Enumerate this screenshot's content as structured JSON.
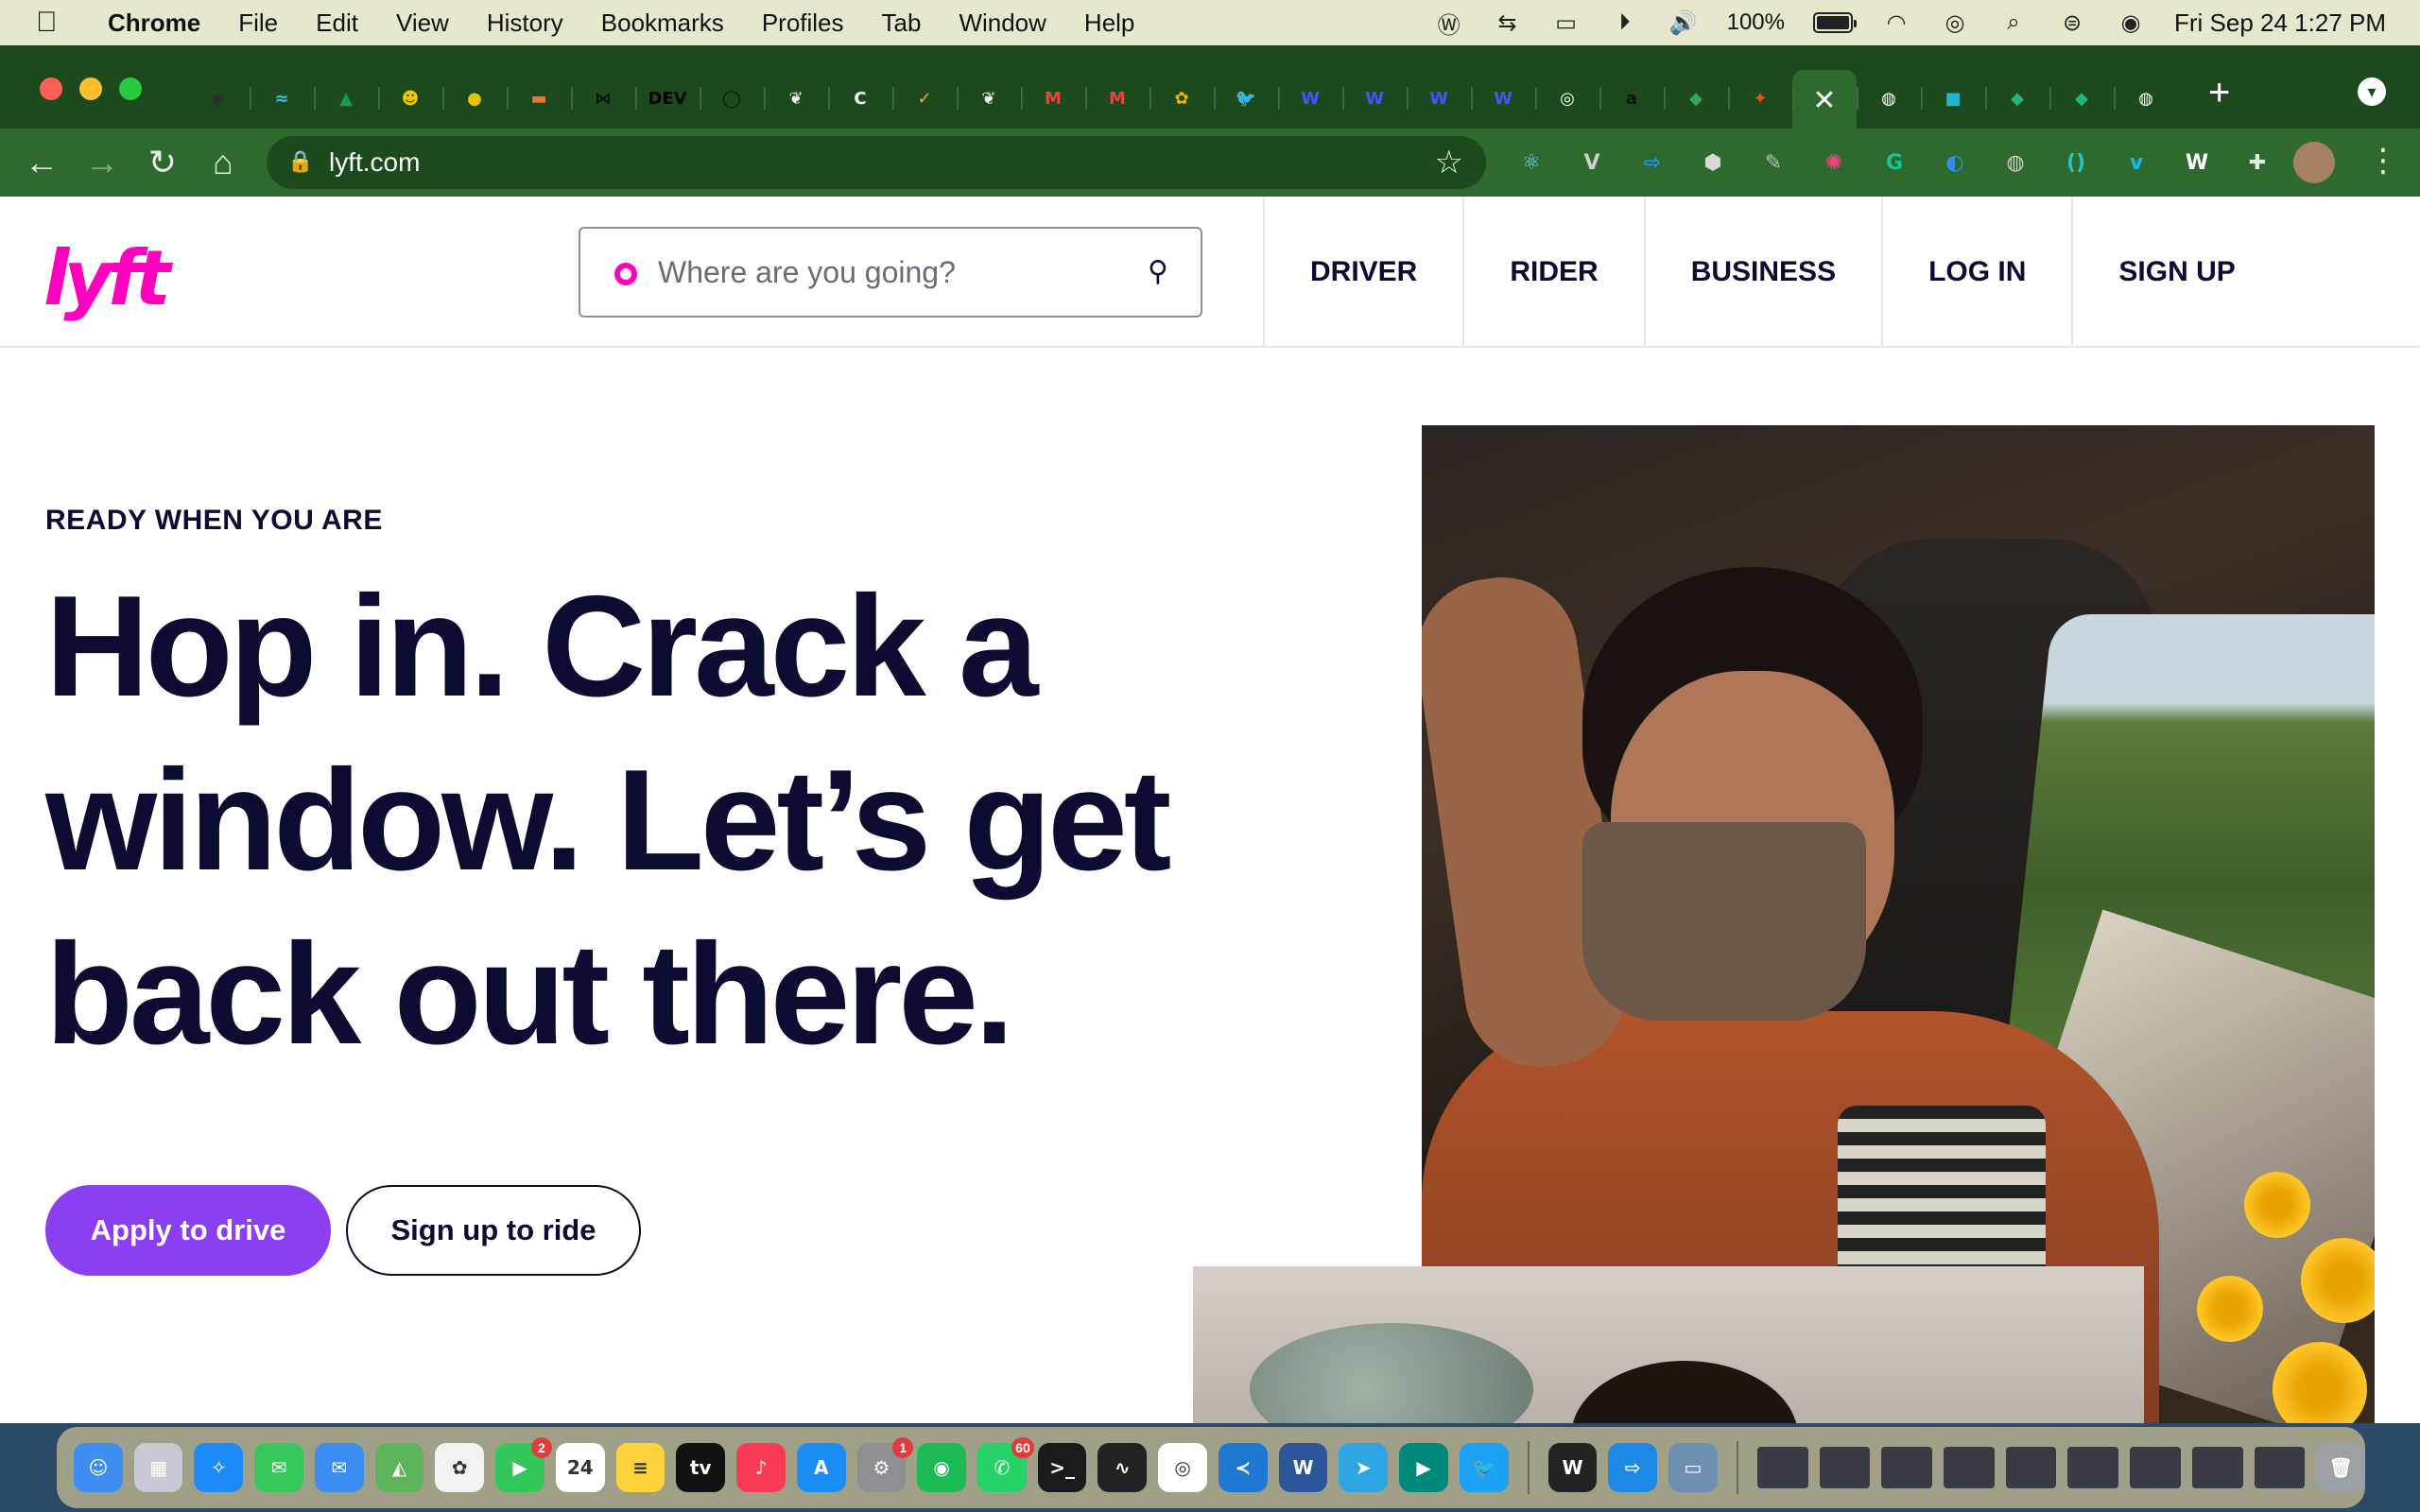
{
  "menubar": {
    "apple": "",
    "app_name": "Chrome",
    "menus": [
      "File",
      "Edit",
      "View",
      "History",
      "Bookmarks",
      "Profiles",
      "Tab",
      "Window",
      "Help"
    ],
    "battery_percent": "100%",
    "battery_level": 1.0,
    "datetime": "Fri Sep 24  1:27 PM"
  },
  "browser": {
    "tabs": [
      {
        "icon": "shield-icon",
        "glyph": "◉",
        "color": "#2d2d2d"
      },
      {
        "icon": "tailwind-icon",
        "glyph": "≈",
        "color": "#38bdf8"
      },
      {
        "icon": "mountain-icon",
        "glyph": "▲",
        "color": "#0f9d58"
      },
      {
        "icon": "emoji-icon",
        "glyph": "☻",
        "color": "#f7c400"
      },
      {
        "icon": "coin-icon",
        "glyph": "●",
        "color": "#e6c300"
      },
      {
        "icon": "stack-icon",
        "glyph": "▬",
        "color": "#e0773c"
      },
      {
        "icon": "bowtie-icon",
        "glyph": "⋈",
        "color": "#111111"
      },
      {
        "icon": "dev-icon",
        "glyph": "DEV",
        "color": "#000000"
      },
      {
        "icon": "github-icon",
        "glyph": "◯",
        "color": "#111111"
      },
      {
        "icon": "leaf-icon",
        "glyph": "❦",
        "color": "#e8f5e9"
      },
      {
        "icon": "c-icon",
        "glyph": "C",
        "color": "#ffffff"
      },
      {
        "icon": "check-icon",
        "glyph": "✓",
        "color": "#f2a93b"
      },
      {
        "icon": "leaf-icon-2",
        "glyph": "❦",
        "color": "#e8f5e9"
      },
      {
        "icon": "gmail-icon",
        "glyph": "M",
        "color": "#ea4335"
      },
      {
        "icon": "gmail-icon-2",
        "glyph": "M",
        "color": "#ea4335"
      },
      {
        "icon": "flower-icon",
        "glyph": "✿",
        "color": "#f4b400"
      },
      {
        "icon": "twitter-icon",
        "glyph": "🐦",
        "color": "#1da1f2"
      },
      {
        "icon": "webflow-icon",
        "glyph": "W",
        "color": "#4353ff"
      },
      {
        "icon": "webflow-icon-2",
        "glyph": "W",
        "color": "#4353ff"
      },
      {
        "icon": "webflow-icon-3",
        "glyph": "W",
        "color": "#4353ff"
      },
      {
        "icon": "webflow-icon-4",
        "glyph": "W",
        "color": "#4353ff"
      },
      {
        "icon": "chrome-icon",
        "glyph": "◎",
        "color": "#ffffff"
      },
      {
        "icon": "amazon-icon",
        "glyph": "a",
        "color": "#111111"
      },
      {
        "icon": "maps-icon",
        "glyph": "◆",
        "color": "#34a853"
      },
      {
        "icon": "figma-icon",
        "glyph": "✦",
        "color": "#f24e1e"
      },
      {
        "icon": "close-icon",
        "glyph": "✕",
        "color": "#2e6a2e",
        "active": true
      },
      {
        "icon": "globe-icon",
        "glyph": "◍",
        "color": "#ffffff"
      },
      {
        "icon": "square-icon",
        "glyph": "■",
        "color": "#1fb6d5"
      },
      {
        "icon": "diamond-icon",
        "glyph": "◆",
        "color": "#1db97a"
      },
      {
        "icon": "diamond-icon-2",
        "glyph": "◆",
        "color": "#1db97a"
      },
      {
        "icon": "globe-icon-2",
        "glyph": "◍",
        "color": "#ffffff"
      }
    ],
    "url": "lyft.com",
    "extensions": [
      {
        "icon": "react-icon",
        "glyph": "⚛",
        "color": "#61dafb"
      },
      {
        "icon": "vue-icon",
        "glyph": "V",
        "color": "#cfcfcf"
      },
      {
        "icon": "arrow-box-icon",
        "glyph": "⇨",
        "color": "#2196f3"
      },
      {
        "icon": "cube-icon",
        "glyph": "⬢",
        "color": "#d8d8d8"
      },
      {
        "icon": "pen-icon",
        "glyph": "✎",
        "color": "#bdbdbd"
      },
      {
        "icon": "color-wheel-icon",
        "glyph": "✺",
        "color": "#ff4081"
      },
      {
        "icon": "grammarly-icon",
        "glyph": "G",
        "color": "#15c39a"
      },
      {
        "icon": "edge-icon",
        "glyph": "◐",
        "color": "#2a8cff"
      },
      {
        "icon": "globe-ext-icon",
        "glyph": "◍",
        "color": "#d0d0d0"
      },
      {
        "icon": "bracket-icon",
        "glyph": "()",
        "color": "#27c6c6"
      },
      {
        "icon": "vimeo-icon",
        "glyph": "v",
        "color": "#1ab7ea"
      },
      {
        "icon": "w-circle-icon",
        "glyph": "W",
        "color": "#ffffff"
      },
      {
        "icon": "puzzle-icon",
        "glyph": "✚",
        "color": "#e5efe5"
      }
    ]
  },
  "site": {
    "logo_text": "lyft",
    "search_placeholder": "Where are you going?",
    "nav": [
      "DRIVER",
      "RIDER",
      "BUSINESS",
      "LOG IN",
      "SIGN UP"
    ],
    "eyebrow": "READY WHEN YOU ARE",
    "headline": "Hop in. Crack a window. Let’s get back out there.",
    "primary_cta": "Apply to drive",
    "secondary_cta": "Sign up to ride",
    "colors": {
      "brand": "#ff00bf",
      "ink": "#0c0b31",
      "purple": "#8c3ff2"
    }
  },
  "dock": {
    "apps": [
      {
        "icon": "finder-icon",
        "color": "#3d8ef0",
        "glyph": "☺"
      },
      {
        "icon": "launchpad-icon",
        "color": "#c9c9d6",
        "glyph": "▦"
      },
      {
        "icon": "safari-icon",
        "color": "#1d8cf8",
        "glyph": "✧"
      },
      {
        "icon": "messages-icon",
        "color": "#35c759",
        "glyph": "✉"
      },
      {
        "icon": "mail-icon",
        "color": "#3b8df0",
        "glyph": "✉"
      },
      {
        "icon": "maps-dock-icon",
        "color": "#5db35a",
        "glyph": "◭"
      },
      {
        "icon": "photos-icon",
        "color": "#f2f2f2",
        "glyph": "✿"
      },
      {
        "icon": "facetime-icon",
        "color": "#32c759",
        "glyph": "▶",
        "badge": "2"
      },
      {
        "icon": "calendar-icon",
        "color": "#ffffff",
        "glyph": "24"
      },
      {
        "icon": "notes-icon",
        "color": "#ffd33a",
        "glyph": "≡"
      },
      {
        "icon": "tv-icon",
        "color": "#111111",
        "glyph": "tv"
      },
      {
        "icon": "music-icon",
        "color": "#fa3b56",
        "glyph": "♪"
      },
      {
        "icon": "appstore-icon",
        "color": "#1b8ef5",
        "glyph": "A"
      },
      {
        "icon": "settings-icon",
        "color": "#8e8e93",
        "glyph": "⚙",
        "badge": "1"
      },
      {
        "icon": "spotify-icon",
        "color": "#1db954",
        "glyph": "◉"
      },
      {
        "icon": "whatsapp-icon",
        "color": "#25d366",
        "glyph": "✆",
        "badge": "60"
      },
      {
        "icon": "terminal-icon",
        "color": "#1a1a1a",
        "glyph": ">_"
      },
      {
        "icon": "activity-icon",
        "color": "#222222",
        "glyph": "∿"
      },
      {
        "icon": "chrome-dock-icon",
        "color": "#ffffff",
        "glyph": "◎"
      },
      {
        "icon": "vscode-icon",
        "color": "#1f78d1",
        "glyph": "≺"
      },
      {
        "icon": "word-icon",
        "color": "#2b579a",
        "glyph": "W"
      },
      {
        "icon": "telegram-icon",
        "color": "#2ca5e0",
        "glyph": "➤"
      },
      {
        "icon": "meet-icon",
        "color": "#00897b",
        "glyph": "▶"
      },
      {
        "icon": "twitter-dock-icon",
        "color": "#1da1f2",
        "glyph": "🐦"
      },
      {
        "icon": "wakatime-icon",
        "color": "#222222",
        "glyph": "W"
      },
      {
        "icon": "arrow-dock-icon",
        "color": "#1e88e5",
        "glyph": "⇨"
      },
      {
        "icon": "preview-icon",
        "color": "#6f8fb0",
        "glyph": "▭"
      }
    ],
    "trash_label": ""
  }
}
